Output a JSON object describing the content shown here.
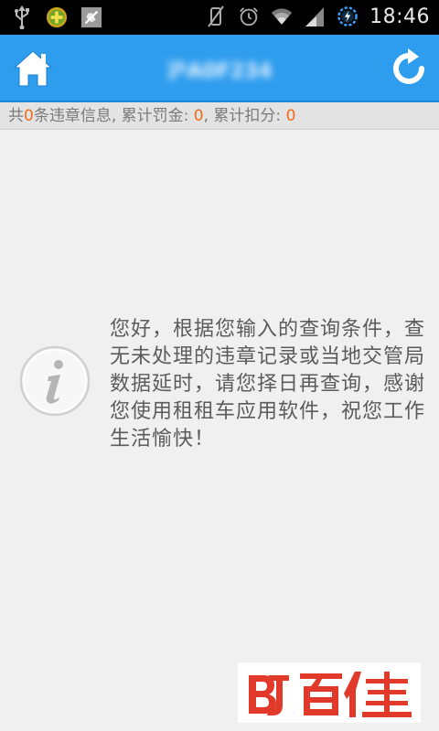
{
  "status_bar": {
    "time": "18:46",
    "left_icons": [
      "usb-icon",
      "app-plus-icon",
      "muted-notification-icon"
    ],
    "right_icons": [
      "vibrate-off-icon",
      "alarm-icon",
      "wifi-icon",
      "signal-icon",
      "battery-charging-icon"
    ]
  },
  "header": {
    "title": "沪A0F234",
    "home_icon": "home-icon",
    "refresh_icon": "refresh-icon"
  },
  "summary": {
    "prefix": "共",
    "count": "0",
    "after_count": "条违章信息, 累计罚金: ",
    "fine": "0",
    "after_fine": ", 累计扣分: ",
    "points": "0"
  },
  "info": {
    "icon": "info-icon",
    "message": "您好，根据您输入的查询条件，查无未处理的违章记录或当地交管局数据延时，请您择日再查询，感谢您使用租租车应用软件，祝您工作生活愉快！"
  },
  "watermark": {
    "text": "BJ百佳"
  },
  "colors": {
    "header": "#2f9dee",
    "accent_number": "#f06a1a",
    "background": "#f0f0f0"
  }
}
